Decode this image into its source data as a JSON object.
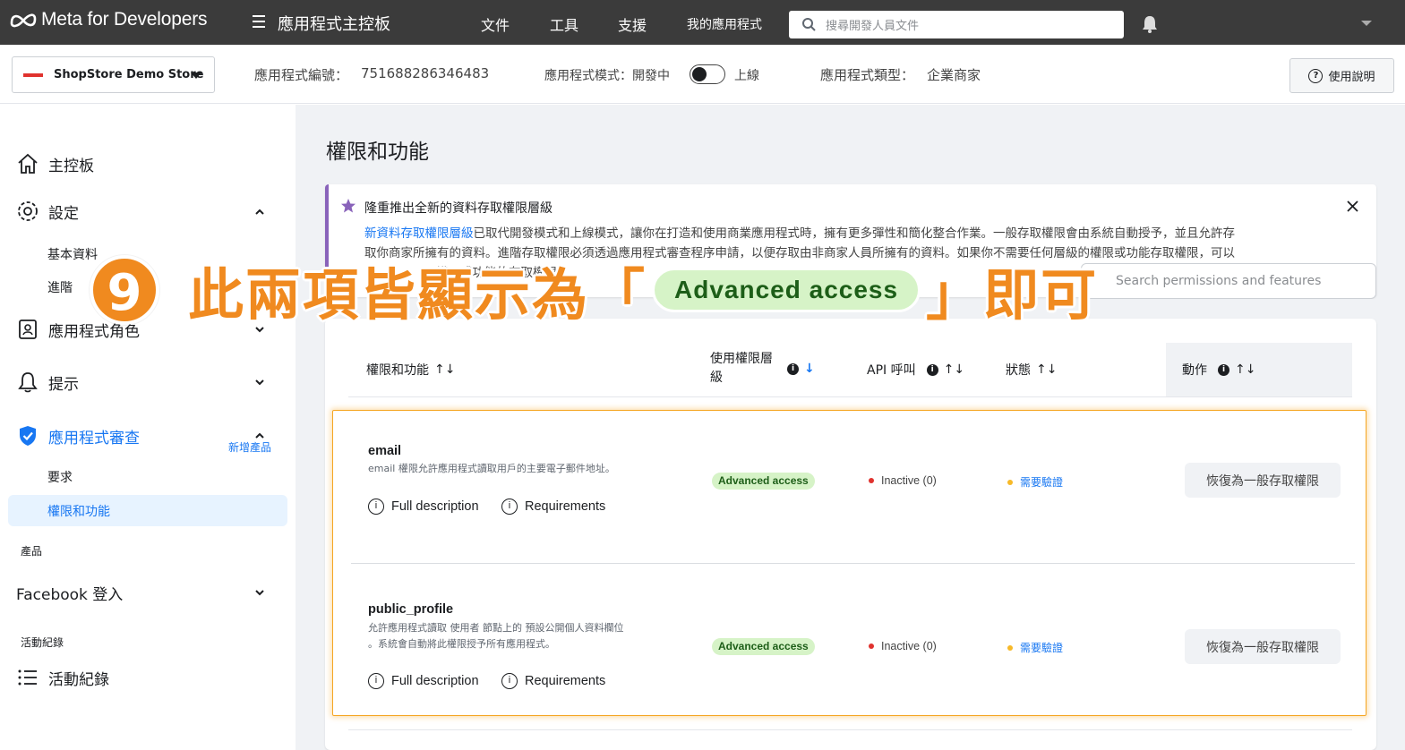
{
  "topbar": {
    "brand": "Meta for Developers",
    "dashboard_title": "應用程式主控板",
    "nav": [
      "文件",
      "工具",
      "支援",
      "我的應用程式"
    ],
    "search_placeholder": "搜尋開發人員文件"
  },
  "appbar": {
    "store_name": "ShopStore Demo Store",
    "app_id_label": "應用程式編號：",
    "app_id": "751688286346483",
    "mode_label": "應用程式模式：開發中",
    "mode_live": "上線",
    "type_label": "應用程式類型：",
    "type_value": "企業商家",
    "help": "使用說明"
  },
  "sidebar": {
    "dashboard": "主控板",
    "settings": "設定",
    "settings_basic": "基本資料",
    "settings_advanced": "進階",
    "roles": "應用程式角色",
    "alerts": "提示",
    "app_review": "應用程式審查",
    "review_requests": "要求",
    "review_permissions": "權限和功能",
    "products_label": "產品",
    "add_product": "新增產品",
    "facebook_login": "Facebook 登入",
    "activity_label": "活動紀錄",
    "activity_log": "活動紀錄"
  },
  "main": {
    "title": "權限和功能",
    "notice_title": "隆重推出全新的資料存取權限層級",
    "notice_link": "新資料存取權限層級",
    "notice_line1": "已取代開發模式和上線模式，讓你在打造和使用商業應用程式時，擁有更多彈性和簡化整合作業。一般存取權限會由系統自動授予，並且允許存",
    "notice_line2": "取你商家所擁有的資料。進階存取權限必須透過應用程式審查程序申請，以便存取由非商家人員所擁有的資料。如果你不需要任何層級的權限或功能存取權限，可以",
    "notice_line3": "權限或功能的存取權限。",
    "search_placeholder": "Search permissions and features",
    "columns": {
      "name": "權限和功能",
      "level": "使用權限層級",
      "api": "API 呼叫",
      "status": "狀態",
      "action": "動作"
    },
    "rows": [
      {
        "name": "email",
        "desc1": "email 權限允許應用程式讀取用戶的主要電子郵件地址。",
        "desc2": "",
        "full_description": "Full description",
        "requirements": "Requirements",
        "level": "Advanced access",
        "api": "Inactive (0)",
        "status": "需要驗證",
        "action": "恢復為一般存取權限"
      },
      {
        "name": "public_profile",
        "desc1": "允許應用程式讀取 使用者 節點上的 預設公開個人資料欄位",
        "desc2": "。系統會自動將此權限授予所有應用程式。",
        "full_description": "Full description",
        "requirements": "Requirements",
        "level": "Advanced access",
        "api": "Inactive (0)",
        "status": "需要驗證",
        "action": "恢復為一般存取權限"
      }
    ]
  },
  "overlay": {
    "step": "9",
    "text_before": "此兩項皆顯示為「",
    "pill": "Advanced access",
    "text_after": "」即可",
    "color": "#f08a1f"
  }
}
